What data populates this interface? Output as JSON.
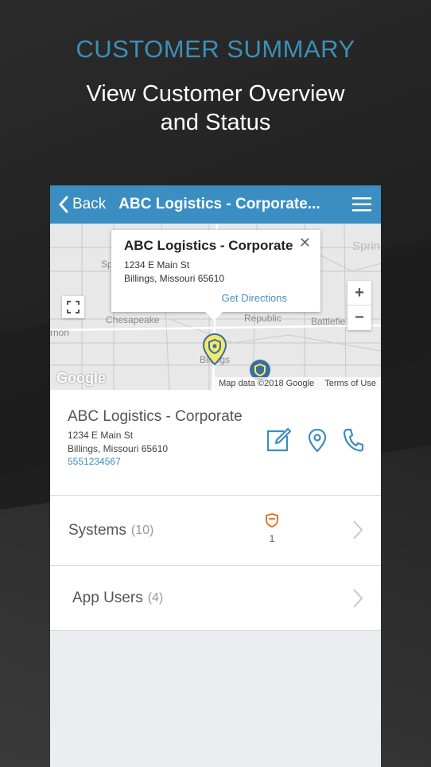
{
  "hero": {
    "title": "CUSTOMER SUMMARY",
    "subtitle_line1": "View Customer Overview",
    "subtitle_line2": "and Status"
  },
  "topbar": {
    "back_label": "Back",
    "title": "ABC Logistics - Corporate..."
  },
  "map": {
    "popup": {
      "name": "ABC Logistics - Corporate",
      "address_line1": "1234 E Main St",
      "address_line2": "Billings, Missouri 65610",
      "directions": "Get Directions",
      "close": "✕"
    },
    "labels": {
      "chesapeake": "Chesapeake",
      "republic": "Republic",
      "battlefield": "Battlefie",
      "billings": "Billings",
      "sprin": "Sprin",
      "arnon": "rnon",
      "sp": "Sp"
    },
    "zoom_in": "+",
    "zoom_out": "−",
    "google": "Google",
    "attribution": "Map data ©2018 Google",
    "terms": "Terms of Use"
  },
  "customer": {
    "name": "ABC Logistics - Corporate",
    "address_line1": "1234 E Main St",
    "address_line2": "Billings, Missouri 65610",
    "phone": "5551234567"
  },
  "rows": {
    "systems": {
      "label": "Systems",
      "count": "(10)",
      "badge_count": "1"
    },
    "app_users": {
      "label": "App Users",
      "count": "(4)"
    }
  },
  "colors": {
    "accent": "#3a8ec2",
    "hero_title": "#3d8fb8",
    "badge": "#e8742a"
  }
}
